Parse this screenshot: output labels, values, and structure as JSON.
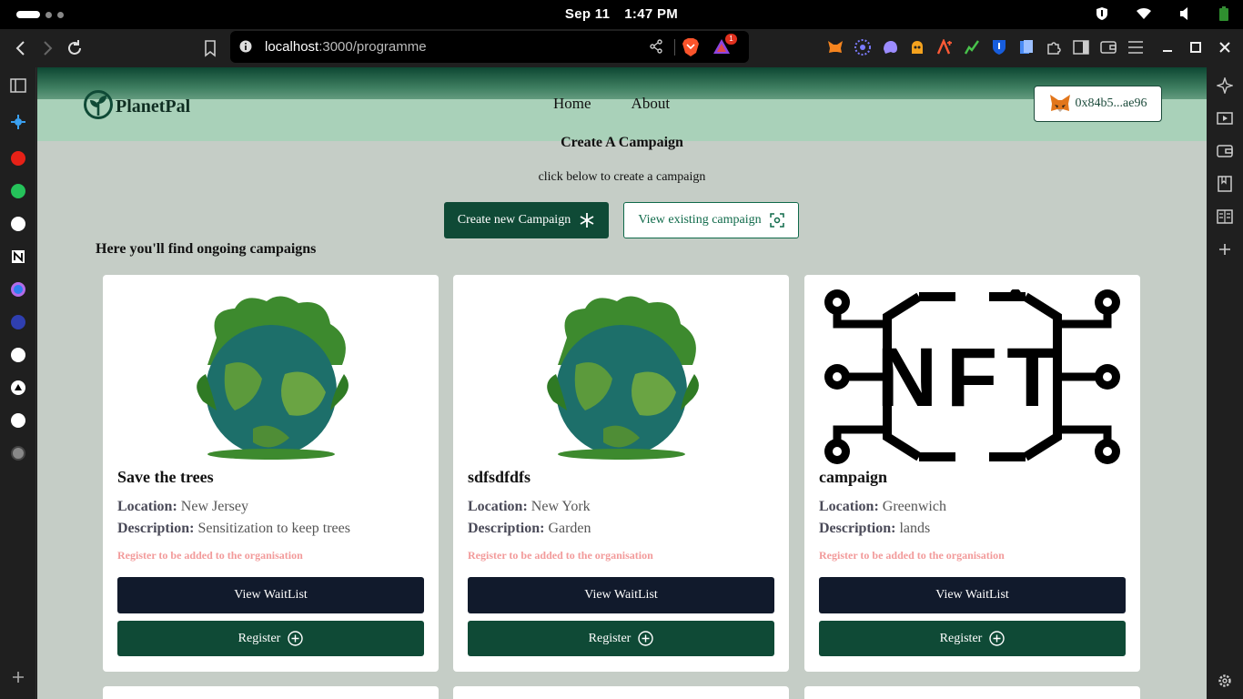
{
  "os": {
    "date": "Sep 11",
    "time": "1:47 PM"
  },
  "browser": {
    "url_host": "localhost",
    "url_path": ":3000/programme",
    "rewards_badge": "1"
  },
  "site": {
    "logo_text": "PlanetPal",
    "nav": [
      "Home",
      "About"
    ],
    "wallet_address": "0x84b5...ae96"
  },
  "create": {
    "title": "Create A Campaign",
    "subtitle": "click below to create a campaign",
    "create_button": "Create new Campaign",
    "view_button": "View existing campaign"
  },
  "campaigns_heading": "Here you'll find ongoing campaigns",
  "labels": {
    "location": "Location:",
    "description": "Description:",
    "register_note": "Register to be added to the organisation",
    "view_waitlist": "View WaitList",
    "register": "Register"
  },
  "campaigns": [
    {
      "name": "Save the trees",
      "location": "New Jersey",
      "description": "Sensitization to keep trees",
      "image": "earth-globe"
    },
    {
      "name": "sdfsdfdfs",
      "location": "New York",
      "description": "Garden",
      "image": "earth-globe"
    },
    {
      "name": "campaign",
      "location": "Greenwich",
      "description": "lands",
      "image": "nft-logo",
      "nft_text": "NFT"
    }
  ],
  "colors": {
    "brand_green": "#0f4a36",
    "dark_navy": "#111a2c",
    "page_bg": "#c5cdc6",
    "note_pink": "#f29a9a"
  }
}
